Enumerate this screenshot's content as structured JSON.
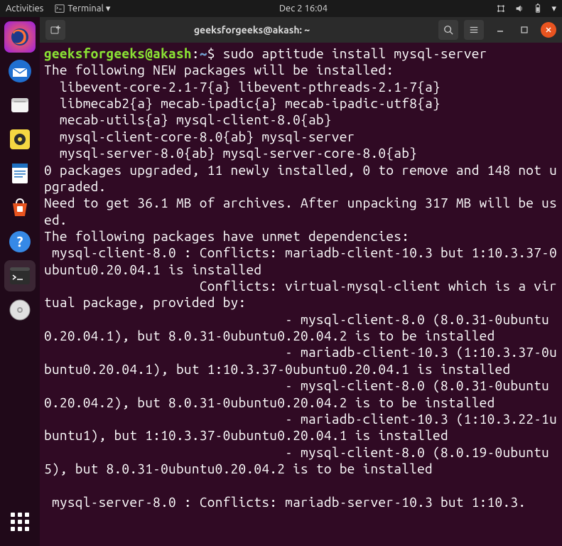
{
  "topbar": {
    "activities": "Activities",
    "app_indicator": "Terminal ▾",
    "datetime": "Dec 2  16:04"
  },
  "dock": {
    "items": [
      {
        "name": "firefox",
        "color": "#ff7139",
        "glyph": "🦊"
      },
      {
        "name": "thunderbird",
        "color": "#1f6fd0",
        "glyph": "✉"
      },
      {
        "name": "files",
        "color": "#e8e8e8",
        "glyph": "📁"
      },
      {
        "name": "rhythmbox",
        "color": "#f5d742",
        "glyph": "◉"
      },
      {
        "name": "libreoffice-writer",
        "color": "#1e70c1",
        "glyph": "📄"
      },
      {
        "name": "software",
        "color": "#e95420",
        "glyph": "🛍"
      },
      {
        "name": "help",
        "color": "#3689e6",
        "glyph": "?"
      },
      {
        "name": "terminal",
        "color": "#2d2d2d",
        "glyph": ">_",
        "active": true
      },
      {
        "name": "disk",
        "color": "#bdbdbd",
        "glyph": "💿"
      }
    ]
  },
  "window": {
    "title": "geeksforgeeks@akash: ~"
  },
  "terminal": {
    "prompt_user": "geeksforgeeks@akash",
    "prompt_sep": ":",
    "prompt_path": "~",
    "prompt_symbol": "$",
    "command": "sudo aptitude install mysql-server",
    "output_lines": [
      "The following NEW packages will be installed:",
      "  libevent-core-2.1-7{a} libevent-pthreads-2.1-7{a} ",
      "  libmecab2{a} mecab-ipadic{a} mecab-ipadic-utf8{a} ",
      "  mecab-utils{a} mysql-client-8.0{ab} ",
      "  mysql-client-core-8.0{ab} mysql-server ",
      "  mysql-server-8.0{ab} mysql-server-core-8.0{ab} ",
      "0 packages upgraded, 11 newly installed, 0 to remove and 148 not upgraded.",
      "Need to get 36.1 MB of archives. After unpacking 317 MB will be used.",
      "The following packages have unmet dependencies:",
      " mysql-client-8.0 : Conflicts: mariadb-client-10.3 but 1:10.3.37-0ubuntu0.20.04.1 is installed",
      "                    Conflicts: virtual-mysql-client which is a virtual package, provided by:",
      "                               - mysql-client-8.0 (8.0.31-0ubuntu0.20.04.1), but 8.0.31-0ubuntu0.20.04.2 is to be installed",
      "                               - mariadb-client-10.3 (1:10.3.37-0ubuntu0.20.04.1), but 1:10.3.37-0ubuntu0.20.04.1 is installed",
      "                               - mysql-client-8.0 (8.0.31-0ubuntu0.20.04.2), but 8.0.31-0ubuntu0.20.04.2 is to be installed",
      "                               - mariadb-client-10.3 (1:10.3.22-1ubuntu1), but 1:10.3.37-0ubuntu0.20.04.1 is installed",
      "                               - mysql-client-8.0 (8.0.19-0ubuntu5), but 8.0.31-0ubuntu0.20.04.2 is to be installed",
      "",
      " mysql-server-8.0 : Conflicts: mariadb-server-10.3 but 1:10.3."
    ]
  }
}
